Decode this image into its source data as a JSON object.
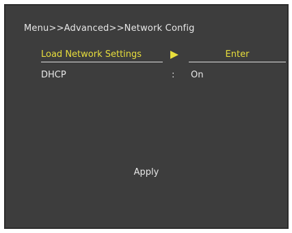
{
  "menu": {
    "breadcrumb": "Menu>>Advanced>>Network Config",
    "items": [
      {
        "label": "Load Network Settings",
        "value": "Enter",
        "selected": true
      },
      {
        "label": "DHCP",
        "separator": ":",
        "value": "On",
        "selected": false
      }
    ],
    "apply_label": "Apply"
  },
  "colors": {
    "background": "#3d3d3d",
    "text": "#e8e8e8",
    "highlight": "#e9df3c"
  },
  "icons": {
    "selection_indicator": "play-arrow-icon"
  }
}
